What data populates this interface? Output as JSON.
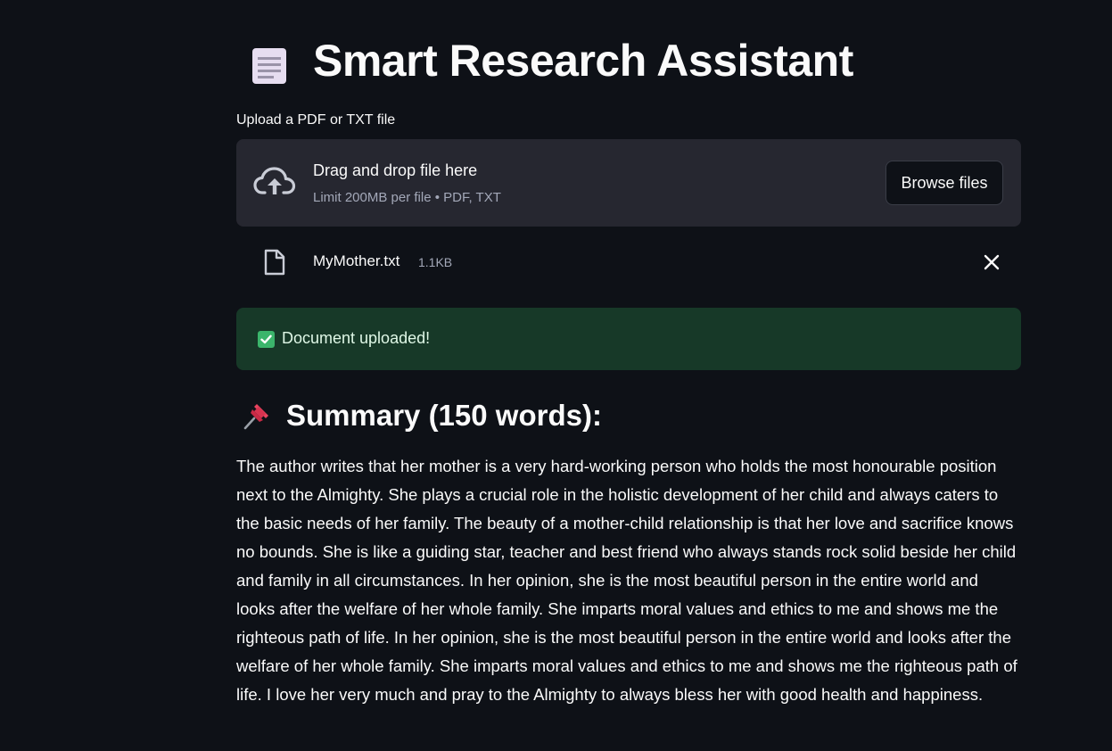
{
  "app": {
    "title": "Smart Research Assistant",
    "title_icon": "document-icon"
  },
  "uploader": {
    "label": "Upload a PDF or TXT file",
    "drop_title": "Drag and drop file here",
    "drop_hint": "Limit 200MB per file • PDF, TXT",
    "browse_label": "Browse files",
    "file": {
      "name": "MyMother.txt",
      "size": "1.1KB"
    }
  },
  "status": {
    "message": "Document uploaded!",
    "color": "#173928"
  },
  "summary": {
    "heading": "Summary (150 words):",
    "heading_icon": "pushpin-icon",
    "text": "The author writes that her mother is a very hard-working person who holds the most honourable position next to the Almighty. She plays a crucial role in the holistic development of her child and always caters to the basic needs of her family. The beauty of a mother-child relationship is that her love and sacrifice knows no bounds. She is like a guiding star, teacher and best friend who always stands rock solid beside her child and family in all circumstances. In her opinion, she is the most beautiful person in the entire world and looks after the welfare of her whole family. She imparts moral values and ethics to me and shows me the righteous path of life. In her opinion, she is the most beautiful person in the entire world and looks after the welfare of her whole family. She imparts moral values and ethics to me and shows me the righteous path of life. I love her very much and pray to the Almighty to always bless her with good health and happiness."
  },
  "theme": {
    "background": "#0e1117",
    "panel": "#262730",
    "text": "#fafafa",
    "muted": "#a3a8b8"
  }
}
